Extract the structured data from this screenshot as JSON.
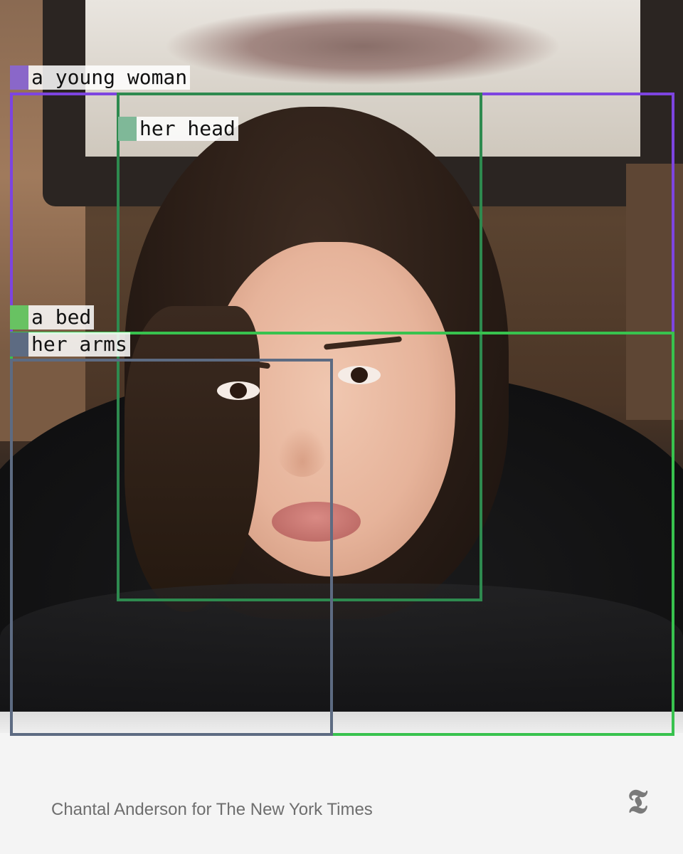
{
  "annotations": [
    {
      "label": "a young woman",
      "color": "#7d44e0",
      "swatch": "#8a67c9"
    },
    {
      "label": "her head",
      "color": "#2e8a4f",
      "swatch": "#7fb898"
    },
    {
      "label": "a bed",
      "color": "#38c24e",
      "swatch": "#68c262"
    },
    {
      "label": "her arms",
      "color": "#5d6b82",
      "swatch": "#5d6b82"
    }
  ],
  "footer": {
    "credit": "Chantal Anderson for The New York Times",
    "logo_icon": "nyt-t-logo-icon"
  }
}
